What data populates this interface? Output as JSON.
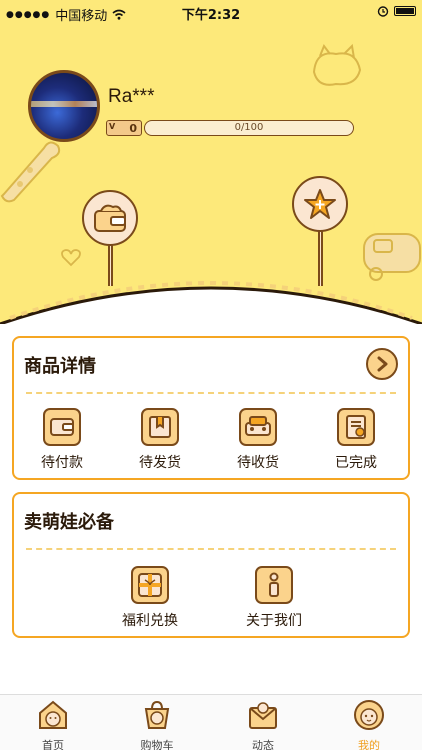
{
  "status_bar": {
    "carrier": "中国移动",
    "time": "下午2:32"
  },
  "profile": {
    "username": "Ra***",
    "level": "0",
    "level_prefix": "V",
    "progress_text": "0/100",
    "progress_fraction": 0
  },
  "header_signs": [
    {
      "icon": "wallet-icon"
    },
    {
      "icon": "star-icon"
    }
  ],
  "orders": {
    "title": "商品详情",
    "more_icon": "chevron-right-icon",
    "items": [
      {
        "label": "待付款",
        "icon": "wallet-icon"
      },
      {
        "label": "待发货",
        "icon": "package-icon"
      },
      {
        "label": "待收货",
        "icon": "delivery-box-icon"
      },
      {
        "label": "已完成",
        "icon": "completed-list-icon"
      }
    ]
  },
  "essentials": {
    "title": "卖萌娃必备",
    "items": [
      {
        "label": "福利兑换",
        "icon": "gift-icon"
      },
      {
        "label": "关于我们",
        "icon": "info-icon"
      }
    ]
  },
  "tabbar": {
    "tabs": [
      {
        "label": "首页",
        "icon": "home-hamster-icon",
        "active": false
      },
      {
        "label": "购物车",
        "icon": "cart-hamster-icon",
        "active": false
      },
      {
        "label": "动态",
        "icon": "envelope-hamster-icon",
        "active": false
      },
      {
        "label": "我的",
        "icon": "profile-hamster-icon",
        "active": true
      }
    ]
  },
  "colors": {
    "header_bg": "#fde97a",
    "accent": "#f5a623",
    "outline": "#7a4a1a",
    "icon_fill": "#fbd38c"
  }
}
